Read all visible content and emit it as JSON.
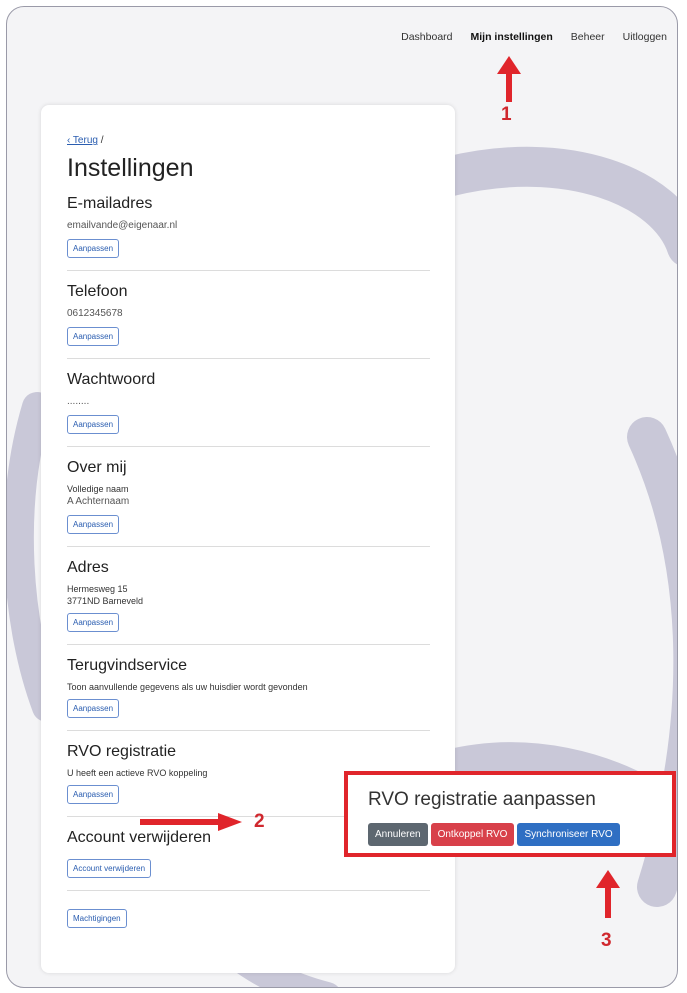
{
  "nav": {
    "items": [
      {
        "label": "Dashboard"
      },
      {
        "label": "Mijn instellingen"
      },
      {
        "label": "Beheer"
      },
      {
        "label": "Uitloggen"
      }
    ]
  },
  "breadcrumb": {
    "back": "‹ Terug",
    "sep": "/"
  },
  "page_title": "Instellingen",
  "sections": {
    "email": {
      "title": "E-mailadres",
      "value": "emailvande@eigenaar.nl",
      "button": "Aanpassen"
    },
    "phone": {
      "title": "Telefoon",
      "value": "0612345678",
      "button": "Aanpassen"
    },
    "password": {
      "title": "Wachtwoord",
      "value": "........",
      "button": "Aanpassen"
    },
    "about": {
      "title": "Over mij",
      "label": "Volledige naam",
      "value": "A Achternaam",
      "button": "Aanpassen"
    },
    "address": {
      "title": "Adres",
      "line1": "Hermesweg 15",
      "line2": "3771ND Barneveld",
      "button": "Aanpassen"
    },
    "recovery": {
      "title": "Terugvindservice",
      "text": "Toon aanvullende gegevens als uw huisdier wordt gevonden",
      "button": "Aanpassen"
    },
    "rvo": {
      "title": "RVO registratie",
      "text": "U heeft een actieve RVO koppeling",
      "button": "Aanpassen"
    },
    "delete": {
      "title": "Account verwijderen",
      "button": "Account verwijderen"
    },
    "authorizations": {
      "button": "Machtigingen"
    }
  },
  "modal": {
    "title": "RVO registratie aanpassen",
    "buttons": {
      "cancel": "Annuleren",
      "disconnect": "Ontkoppel RVO",
      "sync": "Synchroniseer RVO"
    }
  },
  "annotations": {
    "one": "1",
    "two": "2",
    "three": "3"
  },
  "colors": {
    "accent_red": "#e0252b",
    "link_blue": "#2a5db0",
    "sync_blue": "#2f6fc3",
    "disconnect_red": "#d8404a",
    "cancel_gray": "#5d6770",
    "bg_shape": "#c9c8d8"
  }
}
